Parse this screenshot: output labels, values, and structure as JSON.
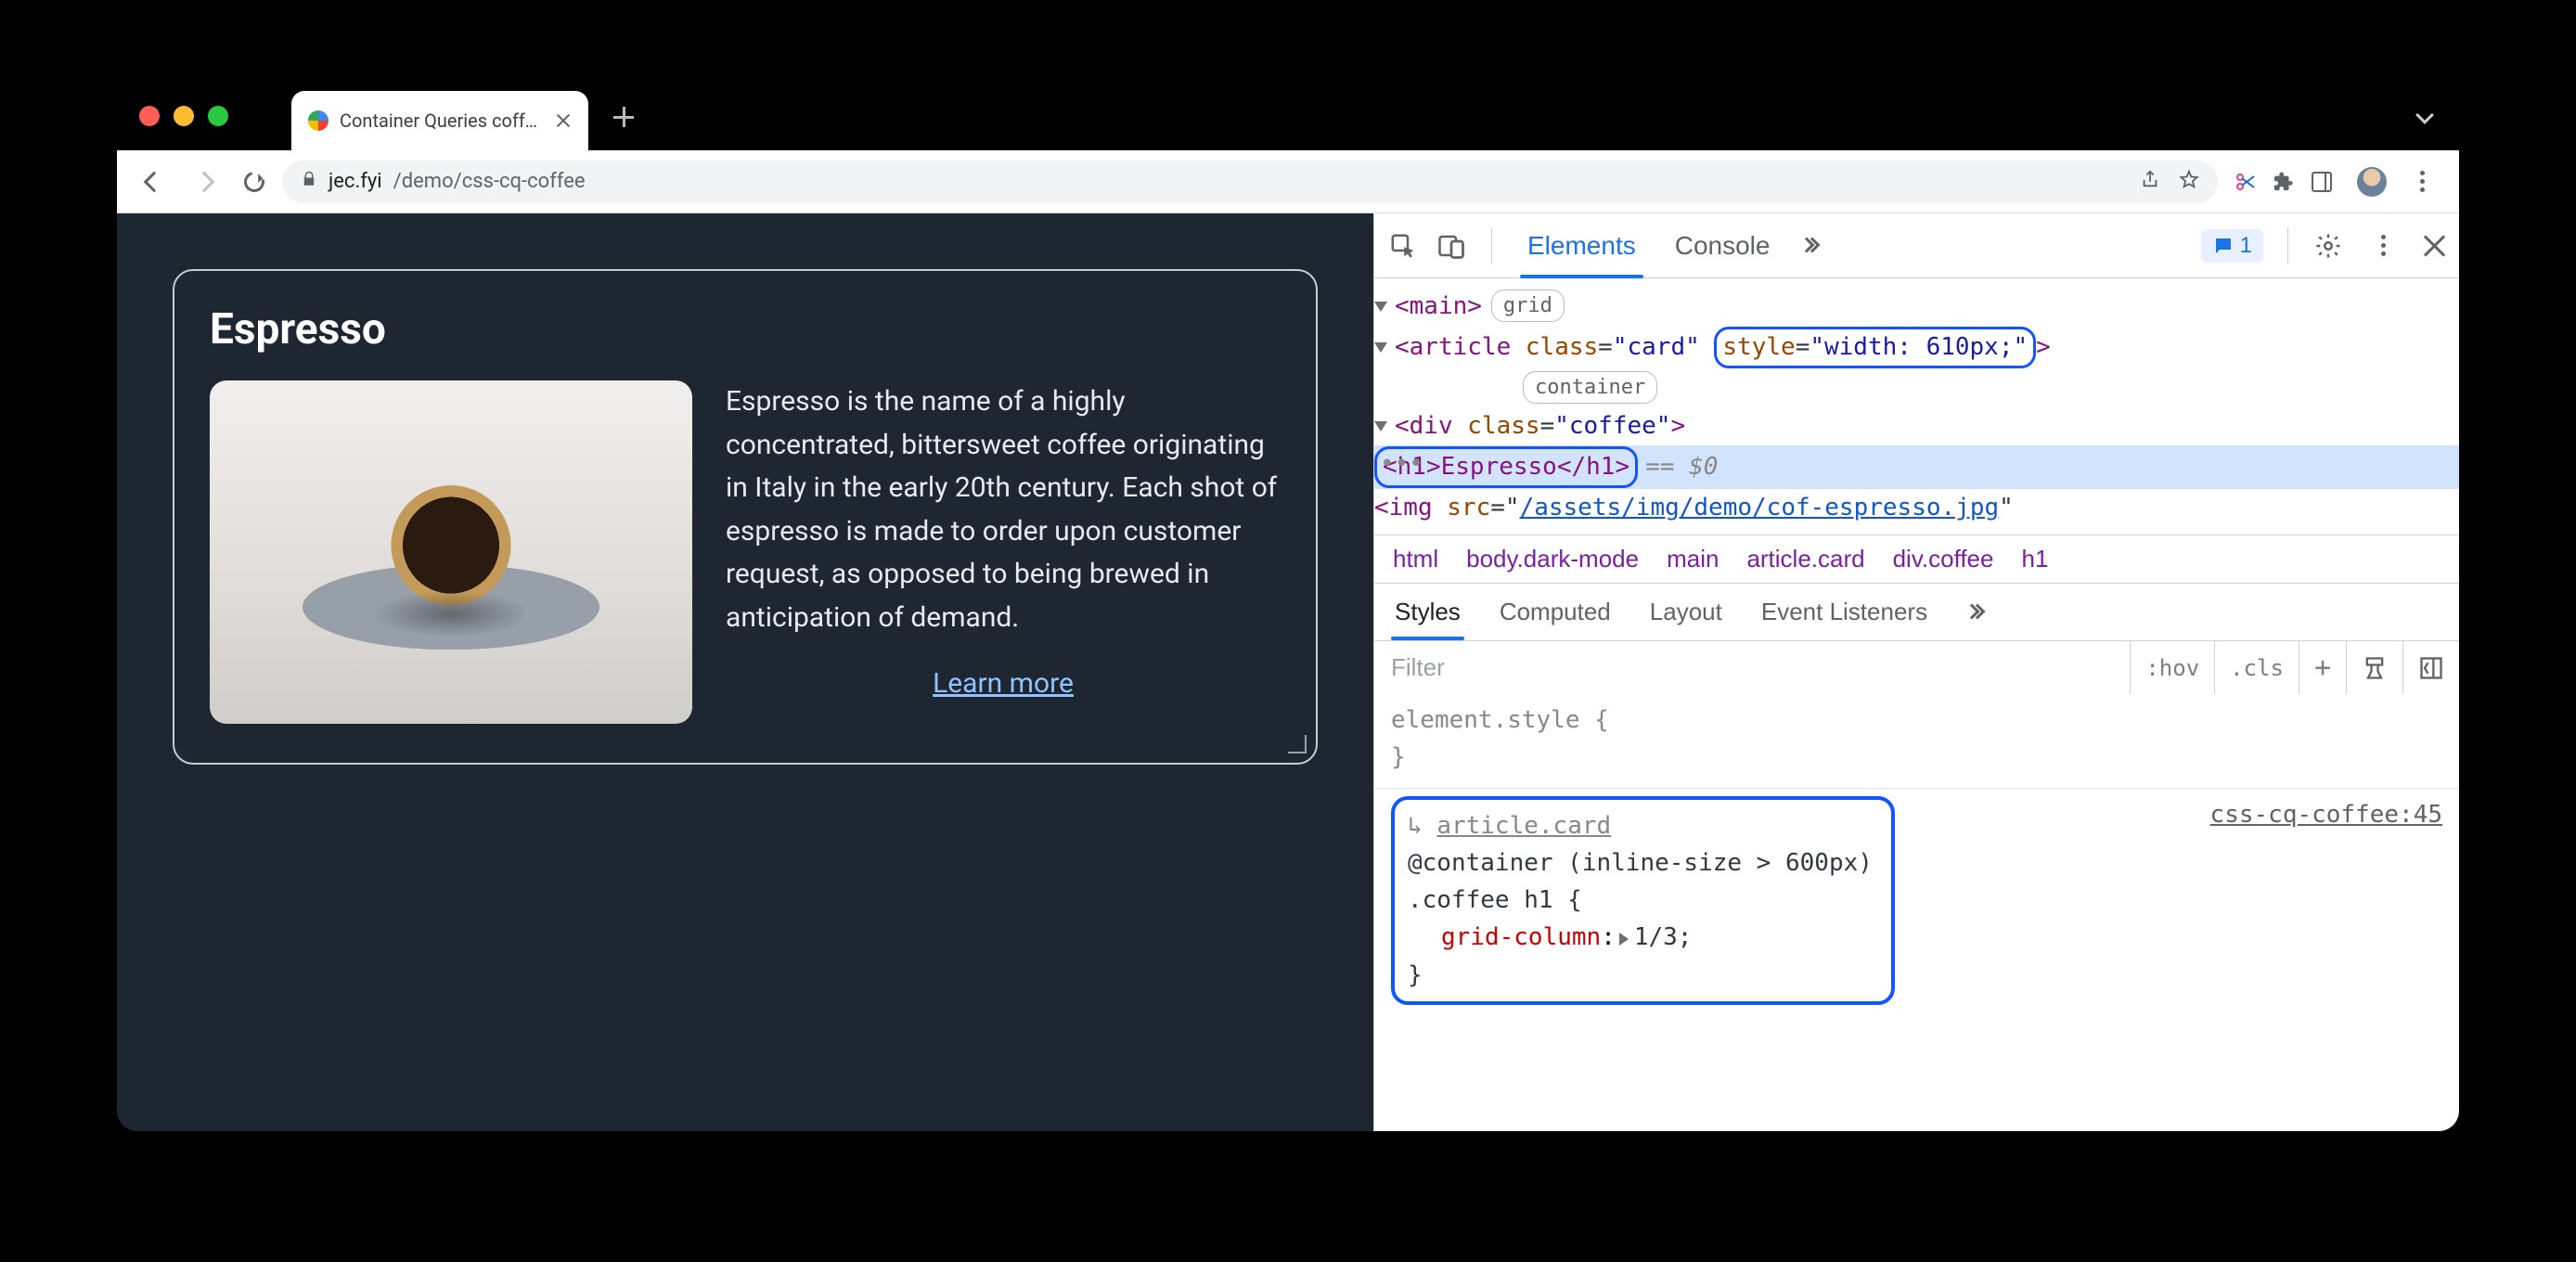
{
  "window": {
    "tab_title": "Container Queries coffee"
  },
  "toolbar": {
    "url_host": "jec.fyi",
    "url_path": "/demo/css-cq-coffee"
  },
  "page": {
    "heading": "Espresso",
    "paragraph": "Espresso is the name of a highly concentrated, bittersweet coffee originating in Italy in the early 20th century. Each shot of espresso is made to order upon customer request, as opposed to being brewed in anticipation of demand.",
    "learn_more": "Learn more"
  },
  "devtools": {
    "tabs": {
      "elements": "Elements",
      "console": "Console"
    },
    "issues_count": "1",
    "dom": {
      "main_open": "<main>",
      "main_badge": "grid",
      "article_open_a": "<article ",
      "article_class_n": "class",
      "article_class_v": "\"card\"",
      "article_style_n": "style",
      "article_style_v": "\"width: 610px;\"",
      "article_close": ">",
      "article_badge": "container",
      "coffee_open_a": "<div ",
      "coffee_class_n": "class",
      "coffee_class_v": "\"coffee\"",
      "coffee_close": ">",
      "h1_full": "<h1>Espresso</h1>",
      "sel_marker": "== $0",
      "img_open": "<img ",
      "img_src_n": "src",
      "img_src_eq": "=\"",
      "img_src_v": "/assets/img/demo/cof-espresso.jpg",
      "img_close": "\""
    },
    "crumbs": {
      "c1": "html",
      "c2": "body.dark-mode",
      "c3": "main",
      "c4": "article.card",
      "c5": "div.coffee",
      "c6": "h1"
    },
    "styles_tabs": {
      "styles": "Styles",
      "computed": "Computed",
      "layout": "Layout",
      "listeners": "Event Listeners"
    },
    "filter": {
      "placeholder": "Filter",
      "hov": ":hov",
      "cls": ".cls"
    },
    "rules": {
      "element_style": "element.style {",
      "close_brace": "}",
      "ancestor": "article.card",
      "container_q": "@container (inline-size > 600px)",
      "selector": ".coffee h1 {",
      "prop": "grid-column",
      "val": "1/3;",
      "src": "css-cq-coffee:45"
    }
  }
}
